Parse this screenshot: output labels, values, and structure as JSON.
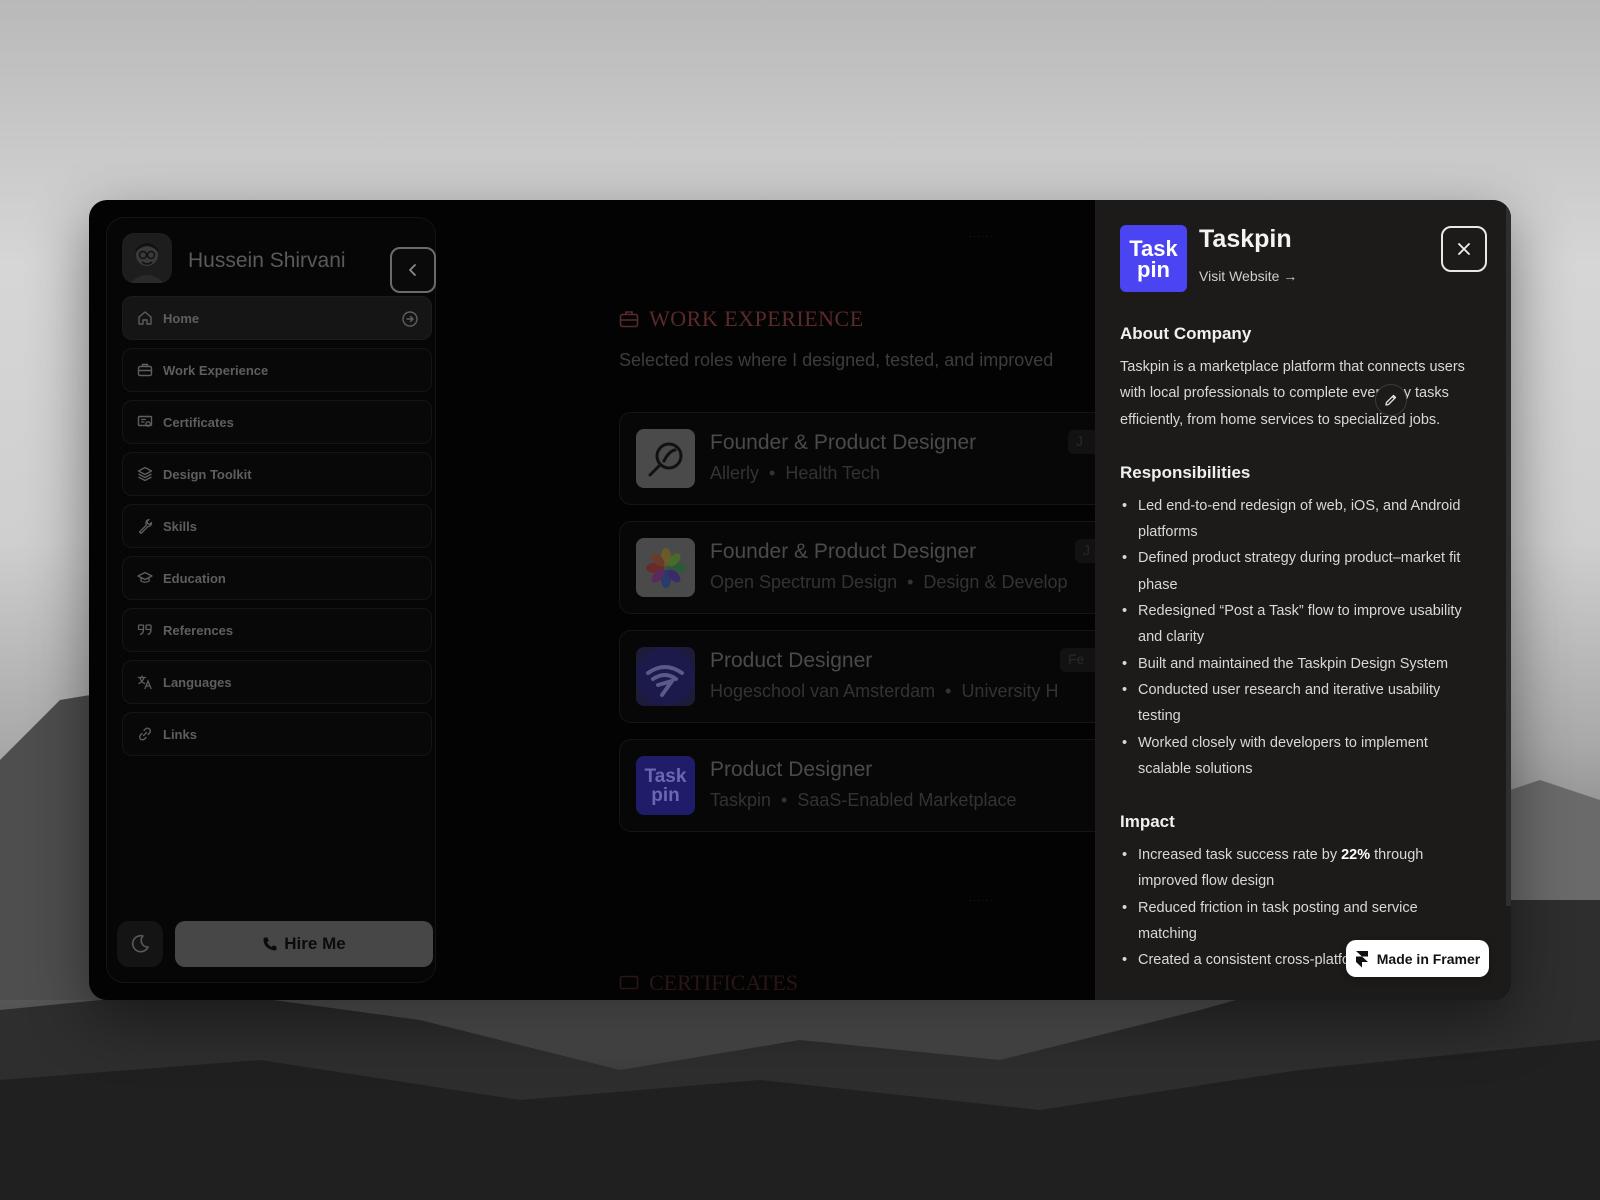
{
  "profile": {
    "name": "Hussein Shirvani"
  },
  "nav": {
    "items": [
      {
        "label": "Home",
        "icon": "home-icon"
      },
      {
        "label": "Work Experience",
        "icon": "briefcase-icon"
      },
      {
        "label": "Certificates",
        "icon": "certificate-icon"
      },
      {
        "label": "Design Toolkit",
        "icon": "layers-icon"
      },
      {
        "label": "Skills",
        "icon": "wrench-icon"
      },
      {
        "label": "Education",
        "icon": "graduation-cap-icon"
      },
      {
        "label": "References",
        "icon": "quote-icon"
      },
      {
        "label": "Languages",
        "icon": "translate-icon"
      },
      {
        "label": "Links",
        "icon": "link-icon"
      }
    ]
  },
  "footer": {
    "hire_label": "Hire Me"
  },
  "main": {
    "section_title": "WORK EXPERIENCE",
    "section_subtitle": "Selected roles where I designed, tested, and improved",
    "jobs": [
      {
        "title": "Founder & Product Designer",
        "company": "Allerly",
        "category": "Health Tech",
        "tag": "J"
      },
      {
        "title": "Founder & Product Designer",
        "company": "Open Spectrum Design",
        "category": "Design & Develop",
        "tag": "J"
      },
      {
        "title": "Product Designer",
        "company": "Hogeschool van Amsterdam",
        "category": "University H",
        "tag": "Fe"
      },
      {
        "title": "Product Designer",
        "company": "Taskpin",
        "category": "SaaS-Enabled Marketplace",
        "tag": ""
      }
    ],
    "next_section_title": "CERTIFICATES",
    "logo_text": {
      "line1": "Task",
      "line2": "pin"
    }
  },
  "panel": {
    "company": "Taskpin",
    "logo_text": {
      "line1": "Task",
      "line2": "pin"
    },
    "visit_label": "Visit Website →",
    "about_heading": "About Company",
    "about_text": "Taskpin is a marketplace platform that connects users with local professionals to complete everyday tasks efficiently, from home services to specialized jobs.",
    "responsibilities_heading": "Responsibilities",
    "responsibilities": [
      "Led end-to-end redesign of web, iOS, and Android platforms",
      "Defined product strategy during product–market fit phase",
      "Redesigned “Post a Task” flow to improve usability and clarity",
      "Built and maintained the Taskpin Design System",
      "Conducted user research and iterative usability testing",
      "Worked closely with developers to implement scalable solutions"
    ],
    "impact_heading": "Impact",
    "impact": {
      "item1_before": "Increased task success rate by ",
      "item1_bold": "22%",
      "item1_after": " through improved flow design",
      "item2": "Reduced friction in task posting and service matching",
      "item3": "Created a consistent cross-platform user"
    }
  },
  "badge": {
    "label": "Made in Framer"
  },
  "colors": {
    "accent_purple": "#4a44f2",
    "panel_bg": "#1c1b1a",
    "app_bg": "#030303"
  }
}
